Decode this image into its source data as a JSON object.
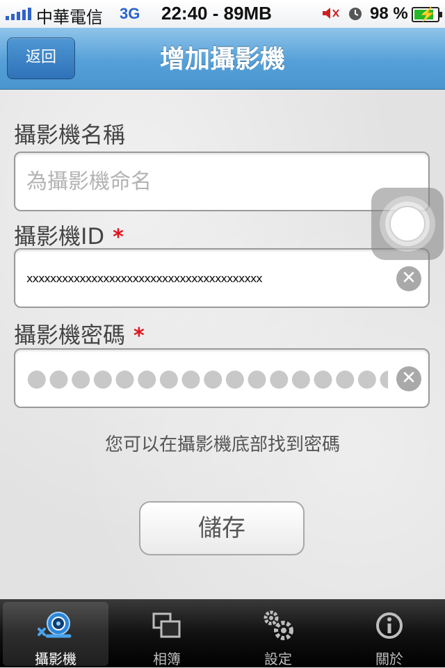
{
  "status_bar": {
    "carrier": "中華電信",
    "network": "3G",
    "time_memory": "22:40 - 89MB",
    "battery": "98 %",
    "battery_level": 0.98,
    "signal_bars": 5,
    "icons": [
      "signal-icon",
      "mute-icon",
      "alarm-clock-icon",
      "battery-charging-icon"
    ]
  },
  "nav": {
    "back_label": "返回",
    "title": "增加攝影機"
  },
  "form": {
    "name_label": "攝影機名稱",
    "name_placeholder": "為攝影機命名",
    "name_value": "",
    "id_label": "攝影機ID",
    "id_required_mark": "*",
    "id_value": "xxxxxxxxxxxxxxxxxxxxxxxxxxxxxxxxxxxxxxxx",
    "password_label": "攝影機密碼",
    "password_required_mark": "*",
    "password_value": "●●●●●●●●●●●●●●●●●",
    "clear_symbol": "✕",
    "hint": "您可以在攝影機底部找到密碼",
    "save_label": "儲存"
  },
  "tabs": [
    {
      "label": "攝影機",
      "icon": "camera-icon",
      "active": true
    },
    {
      "label": "相簿",
      "icon": "album-icon",
      "active": false
    },
    {
      "label": "設定",
      "icon": "gears-icon",
      "active": false
    },
    {
      "label": "關於",
      "icon": "info-icon",
      "active": false
    }
  ],
  "colors": {
    "nav_blue": "#55a0d8",
    "required_red": "#e0141e",
    "battery_green": "#27b827"
  }
}
